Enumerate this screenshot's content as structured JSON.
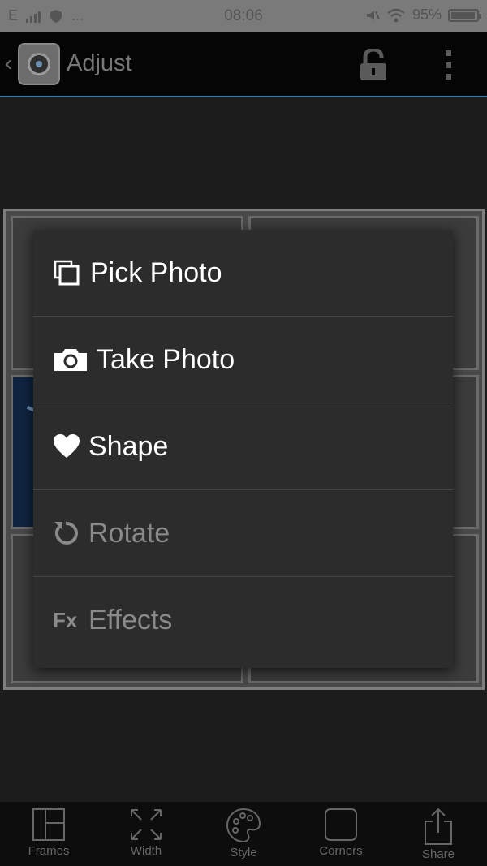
{
  "status_bar": {
    "network": "E",
    "dots": "...",
    "time": "08:06",
    "battery": "95%"
  },
  "action_bar": {
    "title": "Adjust"
  },
  "popup_menu": {
    "items": [
      {
        "label": "Pick Photo",
        "icon": "gallery-icon",
        "enabled": true
      },
      {
        "label": "Take Photo",
        "icon": "camera-icon",
        "enabled": true
      },
      {
        "label": "Shape",
        "icon": "heart-icon",
        "enabled": true
      },
      {
        "label": "Rotate",
        "icon": "rotate-icon",
        "enabled": false
      },
      {
        "label": "Effects",
        "icon": "fx-icon",
        "icon_text": "Fx",
        "enabled": false
      }
    ]
  },
  "toolbar": {
    "items": [
      {
        "label": "Frames",
        "icon": "frames-icon"
      },
      {
        "label": "Width",
        "icon": "width-icon"
      },
      {
        "label": "Style",
        "icon": "palette-icon"
      },
      {
        "label": "Corners",
        "icon": "corners-icon"
      },
      {
        "label": "Share",
        "icon": "share-icon"
      }
    ]
  },
  "colors": {
    "accent": "#3a7ca8",
    "menu_bg": "#2c2c2c",
    "disabled_text": "#8a8a8a"
  }
}
